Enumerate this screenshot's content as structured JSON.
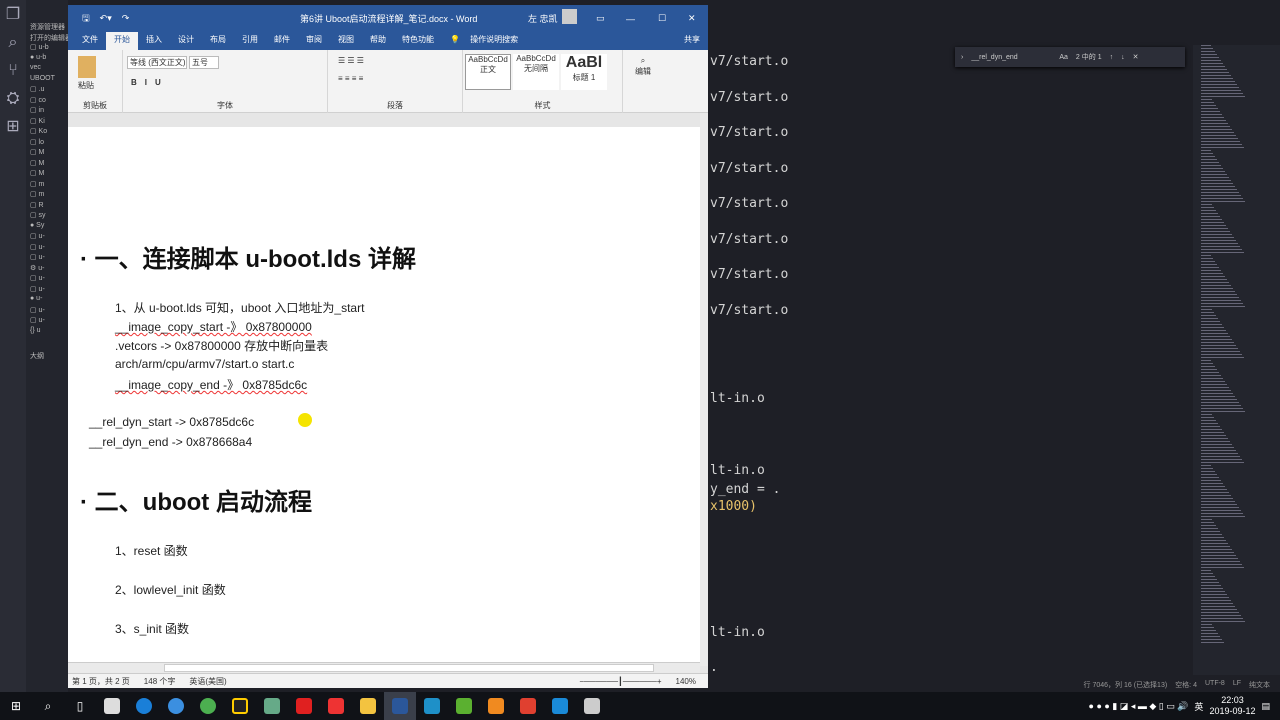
{
  "word": {
    "title": "第6讲 Uboot启动流程详解_笔记.docx  -  Word",
    "user": "左 忠凯",
    "tabs": [
      "文件",
      "开始",
      "插入",
      "设计",
      "布局",
      "引用",
      "邮件",
      "审阅",
      "视图",
      "帮助",
      "特色功能"
    ],
    "tell_me": "操作说明搜索",
    "share": "共享",
    "ribbon": {
      "clipboard": "剪贴板",
      "paste": "粘贴",
      "font_group": "字体",
      "font_name": "等线 (西文正文)",
      "font_size": "五号",
      "paragraph_group": "段落",
      "styles_group": "样式",
      "styles": [
        {
          "preview": "AaBbCcDd",
          "name": "正文"
        },
        {
          "preview": "AaBbCcDd",
          "name": "无间隔"
        },
        {
          "preview": "AaBl",
          "name": "标题 1"
        }
      ],
      "edit": "编辑"
    },
    "doc": {
      "h1": "一、连接脚本 u-boot.lds 详解",
      "lines": [
        "1、从 u-boot.lds 可知，uboot 入口地址为_start",
        "__image_copy_start    -》  0x87800000",
        ".vetcors   ->    0x87800000  存放中断向量表",
        "arch/arm/cpu/armv7/start.o    start.c",
        "__image_copy_end -》  0x8785dc6c"
      ],
      "rel_start": "__rel_dyn_start ->    0x8785dc6c",
      "rel_end": "__rel_dyn_end -> 0x878668a4",
      "h2": "二、uboot 启动流程",
      "items": [
        "1、reset 函数",
        "2、lowlevel_init 函数",
        "3、s_init 函数"
      ]
    },
    "status": {
      "page": "第 1 页，共 2 页",
      "words": "148 个字",
      "lang": "英语(美国)",
      "zoom": "140%"
    }
  },
  "vscode": {
    "explorer_title": "资源管理器",
    "open_editors": "打开的编辑器",
    "folder": "UBOOT",
    "outline": "大纲",
    "find": {
      "query": "__rel_dyn_end",
      "result": "2 中的 1"
    },
    "editor_lines": [
      "v7/start.o",
      "v7/start.o",
      "v7/start.o",
      "v7/start.o",
      "v7/start.o",
      "v7/start.o",
      "v7/start.o",
      "v7/start.o",
      "lt-in.o",
      "lt-in.o",
      "y_end = .",
      "x1000)",
      "lt-in.o",
      "."
    ],
    "status": [
      "行 7046，列 16 (已选择13)",
      "空格: 4",
      "UTF-8",
      "LF",
      "纯文本"
    ]
  },
  "taskbar": {
    "time": "22:03",
    "date": "2019-09-12",
    "ime": "英"
  },
  "colors": {
    "word_blue": "#2b579a",
    "vscode_bg": "#1e1f26"
  }
}
